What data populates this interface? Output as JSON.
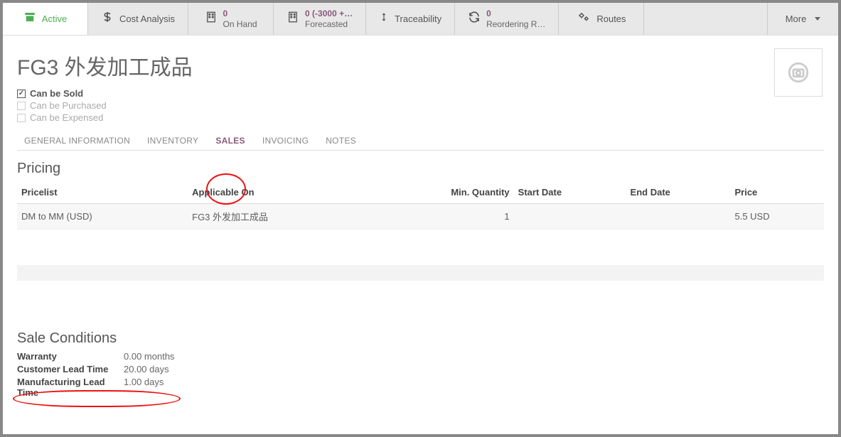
{
  "toolbar": {
    "active": "Active",
    "cost": "Cost Analysis",
    "onhand_num": "0",
    "onhand_lbl": "On Hand",
    "forecast_num": "0 (-3000 +…",
    "forecast_lbl": "Forecasted",
    "trace": "Traceability",
    "reorder_num": "0",
    "reorder_lbl": "Reordering R…",
    "routes": "Routes",
    "more": "More"
  },
  "title": "FG3 外发加工成品",
  "checks": {
    "sold": "Can be Sold",
    "purchased": "Can be Purchased",
    "expensed": "Can be Expensed"
  },
  "tabs": {
    "general": "GENERAL INFORMATION",
    "inventory": "INVENTORY",
    "sales": "SALES",
    "invoicing": "INVOICING",
    "notes": "NOTES"
  },
  "pricing": {
    "title": "Pricing",
    "headers": {
      "pricelist": "Pricelist",
      "applicable": "Applicable On",
      "minqty": "Min. Quantity",
      "start": "Start Date",
      "end": "End Date",
      "price": "Price"
    },
    "row": {
      "pricelist": "DM to MM (USD)",
      "applicable": "FG3 外发加工成品",
      "minqty": "1",
      "start": "",
      "end": "",
      "price": "5.5 USD"
    }
  },
  "cond": {
    "title": "Sale Conditions",
    "warranty_k": "Warranty",
    "warranty_v": "0.00 months",
    "lead_k": "Customer Lead Time",
    "lead_v": "20.00 days",
    "mfg_k": "Manufacturing Lead Time",
    "mfg_v": "1.00 days"
  }
}
